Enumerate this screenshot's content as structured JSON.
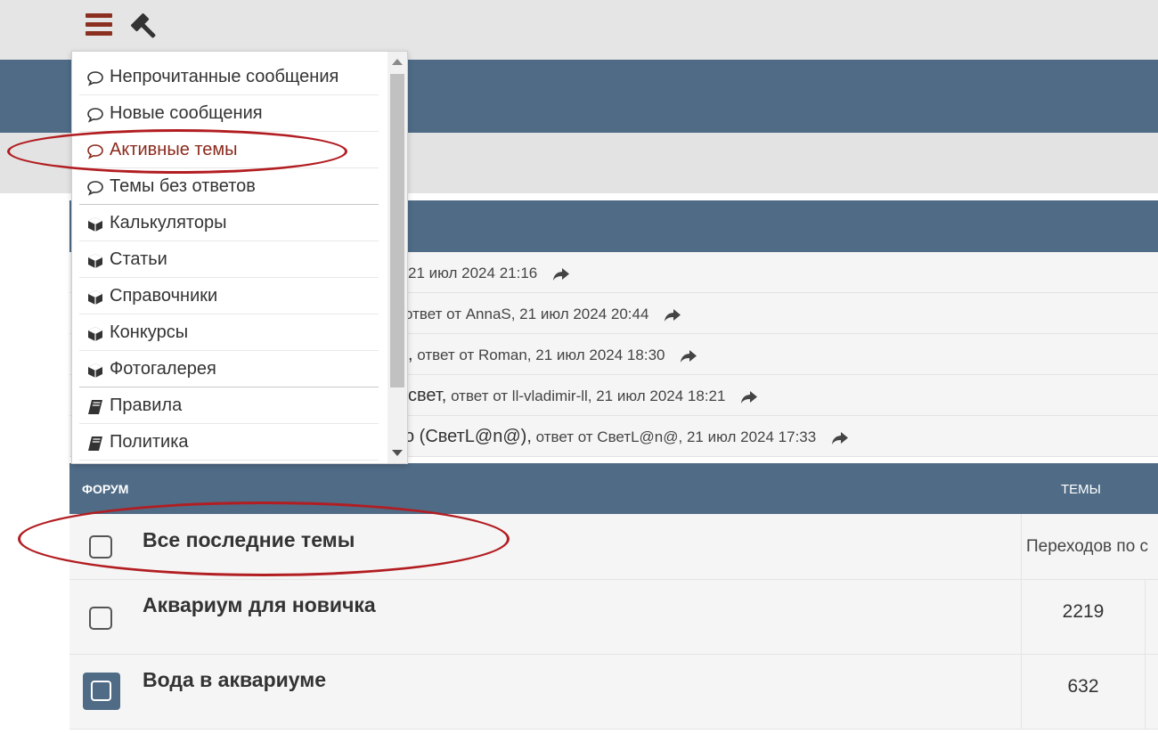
{
  "toolbar": {
    "menu_icon": "hamburger-menu-icon",
    "tool_icon": "gavel-icon"
  },
  "dropdown": {
    "items": [
      {
        "label": "Непрочитанные сообщения",
        "icon": "speech-bubble-icon"
      },
      {
        "label": "Новые сообщения",
        "icon": "speech-bubble-icon"
      },
      {
        "label": "Активные темы",
        "icon": "speech-bubble-icon",
        "active": true
      },
      {
        "label": "Темы без ответов",
        "icon": "speech-bubble-icon"
      },
      {
        "label": "Калькуляторы",
        "icon": "cube-icon"
      },
      {
        "label": "Статьи",
        "icon": "cube-icon"
      },
      {
        "label": "Справочники",
        "icon": "cube-icon"
      },
      {
        "label": "Конкурсы",
        "icon": "cube-icon"
      },
      {
        "label": "Фотогалерея",
        "icon": "cube-icon"
      },
      {
        "label": "Правила",
        "icon": "book-icon"
      },
      {
        "label": "Политика",
        "icon": "book-icon"
      }
    ]
  },
  "recent": {
    "rows": [
      {
        "topic": "",
        "meta": "21 июл 2024 21:16"
      },
      {
        "topic": "",
        "meta": "ответ от AnnaS, 21 июл 2024 20:44"
      },
      {
        "topic": ",",
        "meta": "ответ от Roman, 21 июл 2024 18:30"
      },
      {
        "topic": "свет,",
        "meta": "ответ от ll-vladimir-ll, 21 июл 2024 18:21"
      },
      {
        "topic": "о (СветL@n@),",
        "meta": "ответ от СветL@n@, 21 июл 2024 17:33"
      }
    ]
  },
  "forum_table": {
    "col_forum": "ФОРУМ",
    "col_topics": "ТЕМЫ",
    "rows": [
      {
        "title": "Все последние темы",
        "extra": "Переходов по с"
      },
      {
        "title": "Аквариум для новичка",
        "count": "2219"
      },
      {
        "title": "Вода в аквариуме",
        "count": "632"
      }
    ]
  },
  "colors": {
    "accent": "#4f6b86",
    "brand_red": "#8b3020",
    "highlight_circle": "#b21d21"
  }
}
